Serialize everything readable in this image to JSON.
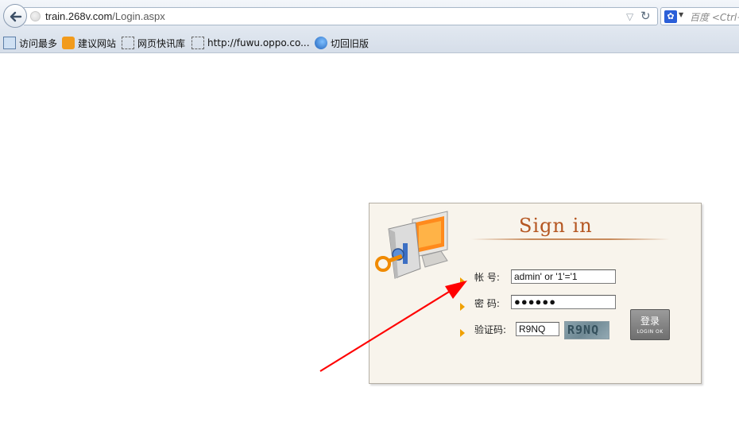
{
  "browser": {
    "url_host": "train.268v.com",
    "url_path": "/Login.aspx",
    "search_placeholder": "百度 <Ctrl+",
    "bookmarks": [
      {
        "label": "访问最多",
        "icon": "visited-icon"
      },
      {
        "label": "建议网站",
        "icon": "suggested-sites-icon"
      },
      {
        "label": "网页快讯库",
        "icon": "web-slice-icon"
      },
      {
        "label": "http://fuwu.oppo.co...",
        "icon": "page-icon"
      },
      {
        "label": "切回旧版",
        "icon": "ie-icon"
      }
    ]
  },
  "login": {
    "title": "Sign in",
    "account_label": "帐  号:",
    "account_value": "admin' or '1'='1",
    "password_label": "密  码:",
    "password_value": "●●●●●●",
    "captcha_label": "验证码:",
    "captcha_value": "R9NQ",
    "captcha_image_text": "R9NQ",
    "login_button_main": "登录",
    "login_button_sub": "LOGIN OK"
  },
  "colors": {
    "title": "#b55621",
    "panel_bg": "#f8f4ec",
    "field_arrow": "#f0a000",
    "annotation_arrow": "#ff0000"
  }
}
